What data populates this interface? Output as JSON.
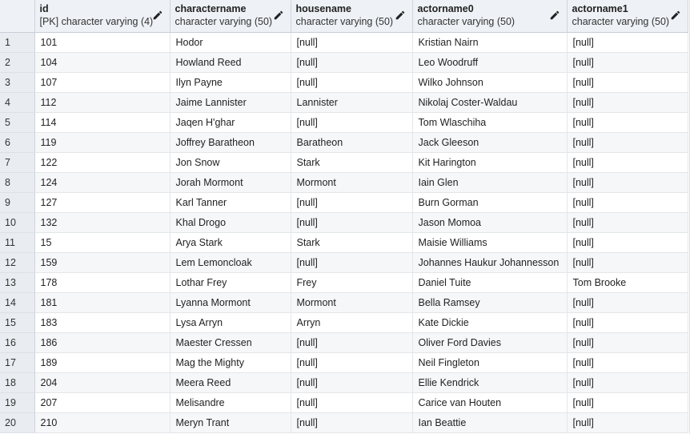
{
  "columns": [
    {
      "name": "id",
      "type": "[PK] character varying (4)"
    },
    {
      "name": "charactername",
      "type": "character varying (50)"
    },
    {
      "name": "housename",
      "type": "character varying (50)"
    },
    {
      "name": "actorname0",
      "type": "character varying (50)"
    },
    {
      "name": "actorname1",
      "type": "character varying (50)"
    }
  ],
  "rows": [
    {
      "n": "1",
      "id": "101",
      "charactername": "Hodor",
      "housename": "[null]",
      "actorname0": "Kristian Nairn",
      "actorname1": "[null]"
    },
    {
      "n": "2",
      "id": "104",
      "charactername": "Howland Reed",
      "housename": "[null]",
      "actorname0": "Leo Woodruff",
      "actorname1": "[null]"
    },
    {
      "n": "3",
      "id": "107",
      "charactername": "Ilyn Payne",
      "housename": "[null]",
      "actorname0": "Wilko Johnson",
      "actorname1": "[null]"
    },
    {
      "n": "4",
      "id": "112",
      "charactername": "Jaime Lannister",
      "housename": "Lannister",
      "actorname0": "Nikolaj Coster-Waldau",
      "actorname1": "[null]"
    },
    {
      "n": "5",
      "id": "114",
      "charactername": "Jaqen H'ghar",
      "housename": "[null]",
      "actorname0": "Tom Wlaschiha",
      "actorname1": "[null]"
    },
    {
      "n": "6",
      "id": "119",
      "charactername": "Joffrey Baratheon",
      "housename": "Baratheon",
      "actorname0": "Jack Gleeson",
      "actorname1": "[null]"
    },
    {
      "n": "7",
      "id": "122",
      "charactername": "Jon Snow",
      "housename": "Stark",
      "actorname0": "Kit Harington",
      "actorname1": "[null]"
    },
    {
      "n": "8",
      "id": "124",
      "charactername": "Jorah Mormont",
      "housename": "Mormont",
      "actorname0": "Iain Glen",
      "actorname1": "[null]"
    },
    {
      "n": "9",
      "id": "127",
      "charactername": "Karl Tanner",
      "housename": "[null]",
      "actorname0": "Burn Gorman",
      "actorname1": "[null]"
    },
    {
      "n": "10",
      "id": "132",
      "charactername": "Khal Drogo",
      "housename": "[null]",
      "actorname0": "Jason Momoa",
      "actorname1": "[null]"
    },
    {
      "n": "11",
      "id": "15",
      "charactername": "Arya Stark",
      "housename": "Stark",
      "actorname0": "Maisie Williams",
      "actorname1": "[null]"
    },
    {
      "n": "12",
      "id": "159",
      "charactername": "Lem Lemoncloak",
      "housename": "[null]",
      "actorname0": "Johannes Haukur Johannesson",
      "actorname1": "[null]"
    },
    {
      "n": "13",
      "id": "178",
      "charactername": "Lothar Frey",
      "housename": "Frey",
      "actorname0": "Daniel Tuite",
      "actorname1": "Tom Brooke"
    },
    {
      "n": "14",
      "id": "181",
      "charactername": "Lyanna Mormont",
      "housename": "Mormont",
      "actorname0": "Bella Ramsey",
      "actorname1": "[null]"
    },
    {
      "n": "15",
      "id": "183",
      "charactername": "Lysa Arryn",
      "housename": "Arryn",
      "actorname0": "Kate Dickie",
      "actorname1": "[null]"
    },
    {
      "n": "16",
      "id": "186",
      "charactername": "Maester Cressen",
      "housename": "[null]",
      "actorname0": "Oliver Ford Davies",
      "actorname1": "[null]"
    },
    {
      "n": "17",
      "id": "189",
      "charactername": "Mag the Mighty",
      "housename": "[null]",
      "actorname0": "Neil Fingleton",
      "actorname1": "[null]"
    },
    {
      "n": "18",
      "id": "204",
      "charactername": "Meera Reed",
      "housename": "[null]",
      "actorname0": "Ellie Kendrick",
      "actorname1": "[null]"
    },
    {
      "n": "19",
      "id": "207",
      "charactername": "Melisandre",
      "housename": "[null]",
      "actorname0": "Carice van Houten",
      "actorname1": "[null]"
    },
    {
      "n": "20",
      "id": "210",
      "charactername": "Meryn Trant",
      "housename": "[null]",
      "actorname0": "Ian Beattie",
      "actorname1": "[null]"
    }
  ]
}
